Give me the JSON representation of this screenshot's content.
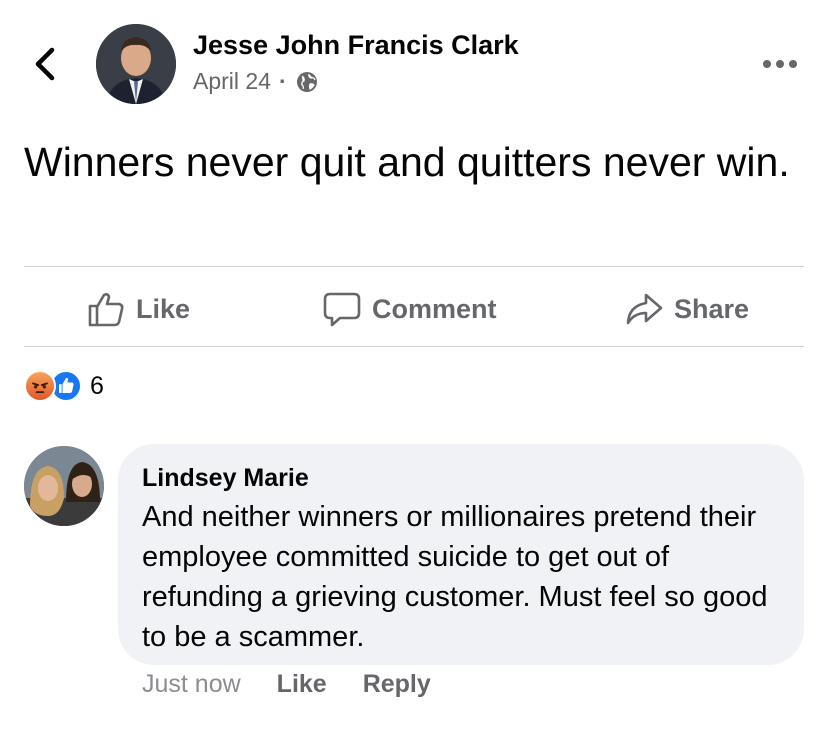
{
  "header": {
    "author_name": "Jesse John Francis Clark",
    "date": "April 24",
    "separator": "·",
    "privacy_icon": "globe-icon",
    "back_icon": "chevron-left-icon",
    "more_icon": "more-horizontal-icon"
  },
  "post": {
    "text": "Winners never quit and quitters never win."
  },
  "actions": {
    "like_label": "Like",
    "comment_label": "Comment",
    "share_label": "Share"
  },
  "reactions": {
    "types": [
      "angry",
      "like"
    ],
    "count": "6"
  },
  "comment": {
    "author": "Lindsey Marie",
    "text": "And neither winners or millionaires pretend their employee committed suicide to get out of refunding a grieving customer. Must feel so good to be a scammer.",
    "time": "Just now",
    "like_label": "Like",
    "reply_label": "Reply"
  },
  "colors": {
    "primary_text": "#050505",
    "secondary_text": "#65676b",
    "bubble_bg": "#f0f2f5",
    "divider": "#ced0d4",
    "like_blue": "#1877f2"
  }
}
